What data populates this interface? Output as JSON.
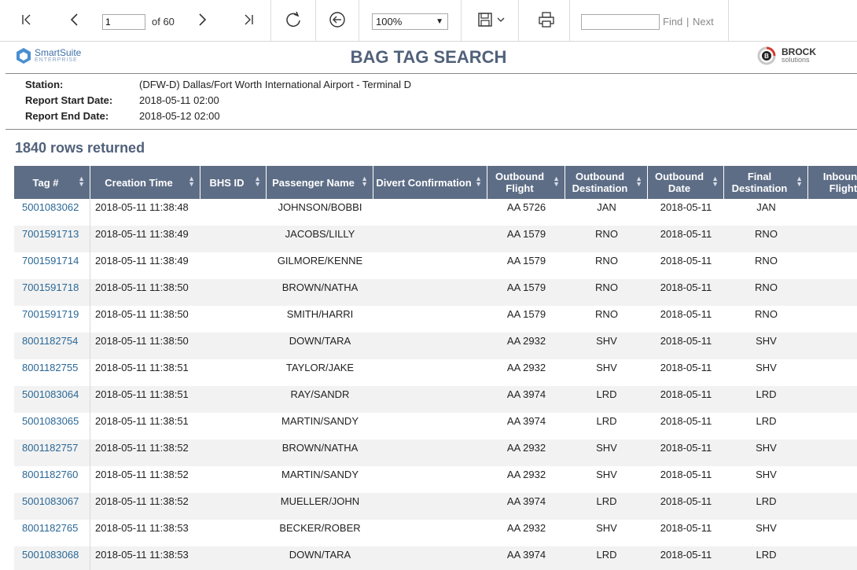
{
  "toolbar": {
    "current_page": "1",
    "of_pages": "of 60",
    "zoom": "100%",
    "find_placeholder": "",
    "find_label": "Find",
    "separator": "|",
    "next_label": "Next"
  },
  "header": {
    "brand_left": "SmartSuite",
    "brand_left_sub": "ENTERPRISE",
    "title": "BAG TAG SEARCH",
    "brand_right": "BROCK",
    "brand_right_sub": "solutions"
  },
  "meta": {
    "station_label": "Station:",
    "station_value": "(DFW-D) Dallas/Fort Worth International Airport - Terminal D",
    "start_label": "Report Start Date:",
    "start_value": "2018-05-11 02:00",
    "end_label": "Report End Date:",
    "end_value": "2018-05-12 02:00"
  },
  "rows_returned": "1840 rows returned",
  "table": {
    "columns": [
      "Tag #",
      "Creation Time",
      "BHS ID",
      "Passenger Name",
      "Divert Confirmation",
      "Outbound Flight",
      "Outbound Destination",
      "Outbound Date",
      "Final Destination",
      "Inbound Flight"
    ],
    "rows": [
      [
        "5001083062",
        "2018-05-11 11:38:48",
        "",
        "JOHNSON/BOBBI",
        "",
        "AA 5726",
        "JAN",
        "2018-05-11",
        "JAN"
      ],
      [
        "7001591713",
        "2018-05-11 11:38:49",
        "",
        "JACOBS/LILLY",
        "",
        "AA 1579",
        "RNO",
        "2018-05-11",
        "RNO"
      ],
      [
        "7001591714",
        "2018-05-11 11:38:49",
        "",
        "GILMORE/KENNE",
        "",
        "AA 1579",
        "RNO",
        "2018-05-11",
        "RNO"
      ],
      [
        "7001591718",
        "2018-05-11 11:38:50",
        "",
        "BROWN/NATHA",
        "",
        "AA 1579",
        "RNO",
        "2018-05-11",
        "RNO"
      ],
      [
        "7001591719",
        "2018-05-11 11:38:50",
        "",
        "SMITH/HARRI",
        "",
        "AA 1579",
        "RNO",
        "2018-05-11",
        "RNO"
      ],
      [
        "8001182754",
        "2018-05-11 11:38:50",
        "",
        "DOWN/TARA",
        "",
        "AA 2932",
        "SHV",
        "2018-05-11",
        "SHV"
      ],
      [
        "8001182755",
        "2018-05-11 11:38:51",
        "",
        "TAYLOR/JAKE",
        "",
        "AA 2932",
        "SHV",
        "2018-05-11",
        "SHV"
      ],
      [
        "5001083064",
        "2018-05-11 11:38:51",
        "",
        "RAY/SANDR",
        "",
        "AA 3974",
        "LRD",
        "2018-05-11",
        "LRD"
      ],
      [
        "5001083065",
        "2018-05-11 11:38:51",
        "",
        "MARTIN/SANDY",
        "",
        "AA 3974",
        "LRD",
        "2018-05-11",
        "LRD"
      ],
      [
        "8001182757",
        "2018-05-11 11:38:52",
        "",
        "BROWN/NATHA",
        "",
        "AA 2932",
        "SHV",
        "2018-05-11",
        "SHV"
      ],
      [
        "8001182760",
        "2018-05-11 11:38:52",
        "",
        "MARTIN/SANDY",
        "",
        "AA 2932",
        "SHV",
        "2018-05-11",
        "SHV"
      ],
      [
        "5001083067",
        "2018-05-11 11:38:52",
        "",
        "MUELLER/JOHN",
        "",
        "AA 3974",
        "LRD",
        "2018-05-11",
        "LRD"
      ],
      [
        "8001182765",
        "2018-05-11 11:38:53",
        "",
        "BECKER/ROBER",
        "",
        "AA 2932",
        "SHV",
        "2018-05-11",
        "SHV"
      ],
      [
        "5001083068",
        "2018-05-11 11:38:53",
        "",
        "DOWN/TARA",
        "",
        "AA 3974",
        "LRD",
        "2018-05-11",
        "LRD"
      ]
    ]
  },
  "colors": {
    "header_bg": "#5d6d86",
    "title": "#51617a",
    "link": "#2a6896",
    "row_alt": "#f2f2f2"
  }
}
